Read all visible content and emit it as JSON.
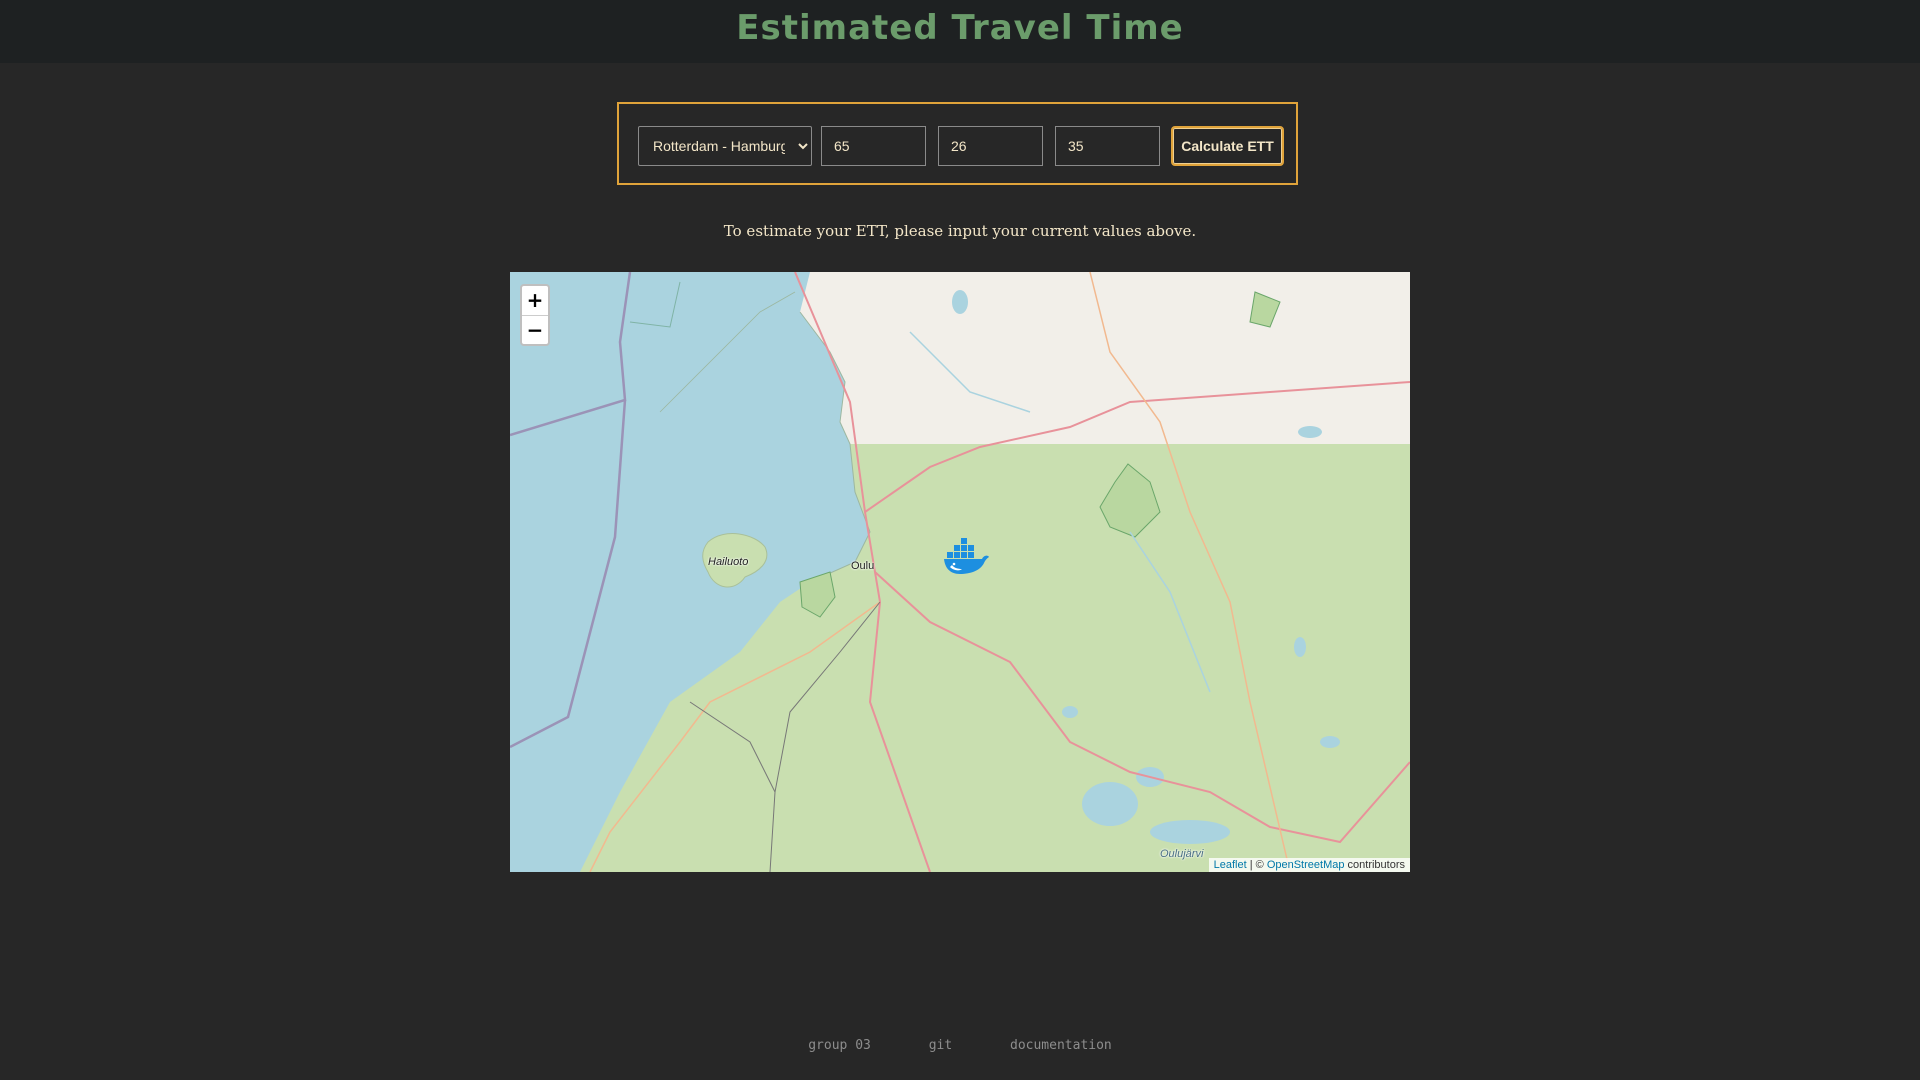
{
  "header": {
    "title": "Estimated Travel Time"
  },
  "form": {
    "route_selected": "Rotterdam - Hamburg",
    "input_1": "65",
    "input_2": "26",
    "input_3": "35",
    "calculate_label": "Calculate ETT"
  },
  "hint_text": "To estimate your ETT, please input your current values above.",
  "map": {
    "zoom_in_label": "+",
    "zoom_out_label": "−",
    "place_labels": {
      "hailuoto": "Hailuoto",
      "oulu": "Oulu",
      "oulujarvi": "Oulujärvi"
    },
    "attribution": {
      "leaflet": "Leaflet",
      "separator": " | © ",
      "osm": "OpenStreetMap",
      "suffix": " contributors"
    },
    "marker_icon": "ship-whale-icon"
  },
  "footer": {
    "group": "group 03",
    "git": "git",
    "docs": "documentation"
  },
  "colors": {
    "accent": "#e0a33a",
    "title_green": "#6b9c6b",
    "sea": "#aad3df",
    "land": "#c9dfb0"
  }
}
